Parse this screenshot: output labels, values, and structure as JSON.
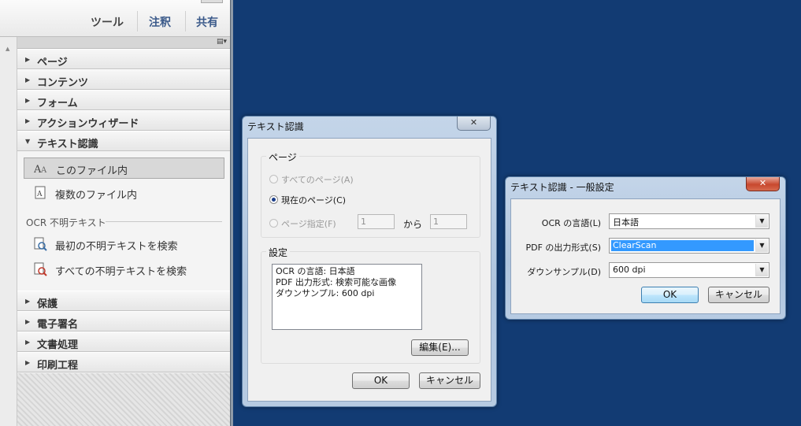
{
  "toolbar": {
    "tools": "ツール",
    "comment": "注釈",
    "share": "共有"
  },
  "panel": {
    "sections_top": [
      "ページ",
      "コンテンツ",
      "フォーム",
      "アクションウィザード"
    ],
    "open_section": "テキスト認識",
    "open_items": [
      "このファイル内",
      "複数のファイル内"
    ],
    "ocr_heading": "OCR 不明テキスト",
    "ocr_items": [
      "最初の不明テキストを検索",
      "すべての不明テキストを検索"
    ],
    "sections_bottom": [
      "保護",
      "電子署名",
      "文書処理",
      "印刷工程"
    ]
  },
  "dialog_ocr": {
    "title": "テキスト認識",
    "close": "✕",
    "page_group": "ページ",
    "radio_all": "すべてのページ(A)",
    "radio_current": "現在のページ(C)",
    "radio_range": "ページ指定(F)",
    "range_from": "1",
    "range_to_label": "から",
    "range_to": "1",
    "settings_group": "設定",
    "settings_lines": [
      "OCR の言語: 日本語",
      "PDF 出力形式: 検索可能な画像",
      "ダウンサンプル: 600 dpi"
    ],
    "edit_button": "編集(E)...",
    "ok": "OK",
    "cancel": "キャンセル"
  },
  "dialog_settings": {
    "title": "テキスト認識 - 一般設定",
    "close": "✕",
    "lang_label": "OCR の言語(L)",
    "lang_value": "日本語",
    "format_label": "PDF の出力形式(S)",
    "format_value": "ClearScan",
    "downsample_label": "ダウンサンプル(D)",
    "downsample_value": "600 dpi",
    "ok": "OK",
    "cancel": "キャンセル"
  },
  "colors": {
    "desktop": "#123b73",
    "selection": "#3399ff"
  }
}
